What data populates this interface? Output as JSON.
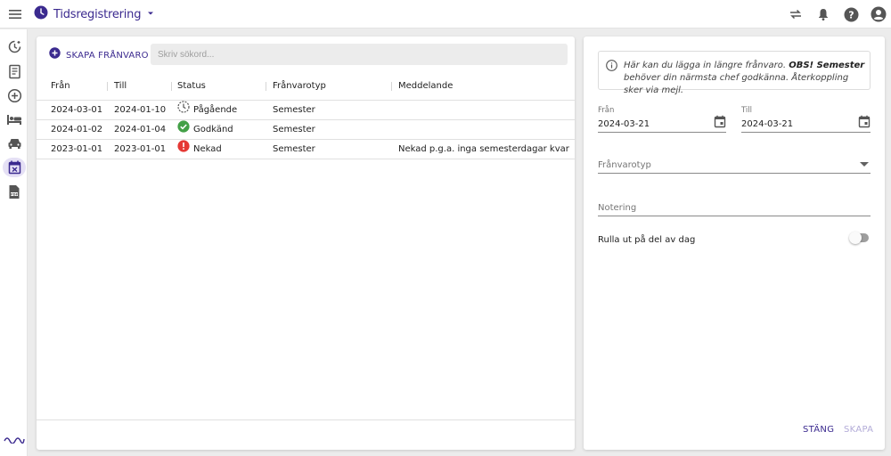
{
  "header": {
    "app_title": "Tidsregistrering",
    "icons": [
      "menu-icon",
      "clock-icon",
      "arrow-drop-down-icon",
      "swap-icon",
      "bell-icon",
      "help-icon",
      "account-icon"
    ]
  },
  "sidebar": {
    "items": [
      {
        "icon": "time-history-icon",
        "active": false
      },
      {
        "icon": "receipt-icon",
        "active": false
      },
      {
        "icon": "add-circle-icon",
        "active": false
      },
      {
        "icon": "bed-icon",
        "active": false
      },
      {
        "icon": "car-icon",
        "active": false
      },
      {
        "icon": "calendar-x-icon",
        "active": true
      },
      {
        "icon": "pdf-file-icon",
        "active": false
      }
    ],
    "logo": "wave-logo-icon"
  },
  "list": {
    "create_label": "SKAPA FRÅNVARO",
    "search_placeholder": "Skriv sökord...",
    "columns": [
      "Från",
      "Till",
      "Status",
      "Frånvarotyp",
      "Meddelande"
    ],
    "rows": [
      {
        "from": "2024-03-01",
        "to": "2024-01-10",
        "status": "Pågående",
        "status_icon": "pending-clock-icon",
        "type": "Semester",
        "message": ""
      },
      {
        "from": "2024-01-02",
        "to": "2024-01-04",
        "status": "Godkänd",
        "status_icon": "check-circle-icon",
        "type": "Semester",
        "message": ""
      },
      {
        "from": "2023-01-01",
        "to": "2023-01-01",
        "status": "Nekad",
        "status_icon": "error-circle-icon",
        "type": "Semester",
        "message": "Nekad p.g.a. inga semesterdagar kvar"
      }
    ]
  },
  "form": {
    "info_prefix": "Här kan du lägga in längre frånvaro. ",
    "info_bold": "OBS! Semester",
    "info_suffix": " behöver din närmsta chef godkänna. Återkoppling sker via mejl.",
    "from_label": "Från",
    "from_value": "2024-03-21",
    "to_label": "Till",
    "to_value": "2024-03-21",
    "type_placeholder": "Frånvarotyp",
    "note_placeholder": "Notering",
    "partial_day_label": "Rulla ut på del av dag",
    "partial_day_on": false,
    "close_label": "STÄNG",
    "create_label": "SKAPA"
  },
  "colors": {
    "brand": "#3b2a8f",
    "approved": "#43a047",
    "rejected": "#e53935",
    "disabled": "#b3acd8"
  }
}
